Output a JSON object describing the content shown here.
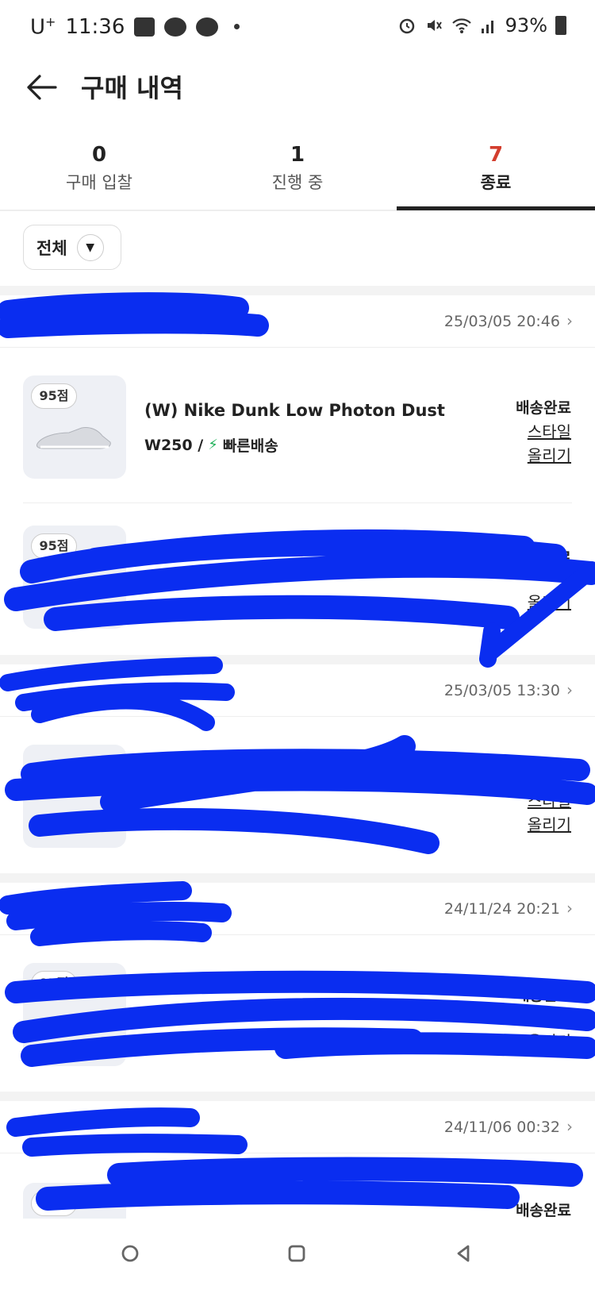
{
  "status_bar": {
    "carrier": "U",
    "carrier_sup": "+",
    "time": "11:36",
    "battery": "93%"
  },
  "header": {
    "title": "구매 내역"
  },
  "tabs": [
    {
      "count": "0",
      "label": "구매 입찰"
    },
    {
      "count": "1",
      "label": "진행 중"
    },
    {
      "count": "7",
      "label": "종료"
    }
  ],
  "filter": {
    "label": "전체"
  },
  "orders": [
    {
      "date": "25/03/05 20:46",
      "items": [
        {
          "score": "95점",
          "name": "(W) Nike Dunk Low Photon Dust",
          "size": "W250 /",
          "delivery": "빠른배송",
          "status": "배송완료",
          "link": "스타일 올리기"
        },
        {
          "score": "95점",
          "name": "",
          "size": "",
          "delivery": "",
          "status": "배송완료",
          "link": "올리기"
        }
      ]
    },
    {
      "date": "25/03/05 13:30",
      "items": [
        {
          "score": "",
          "name": "",
          "size": "",
          "delivery": "",
          "status": "",
          "link": "스타일 올리기"
        }
      ]
    },
    {
      "date": "24/11/24 20:21",
      "items": [
        {
          "score": "95점",
          "name": "",
          "size": "",
          "delivery": "",
          "status": "배송완료",
          "link": "올리기"
        }
      ]
    },
    {
      "date": "24/11/06 00:32",
      "items": [
        {
          "score": "95",
          "name": "",
          "size": "",
          "delivery": "",
          "status": "배송완료",
          "link": ""
        }
      ]
    }
  ],
  "colors": {
    "accent_red": "#d33e2e",
    "bolt_green": "#20b15a",
    "redaction_blue": "#0a2df0"
  }
}
